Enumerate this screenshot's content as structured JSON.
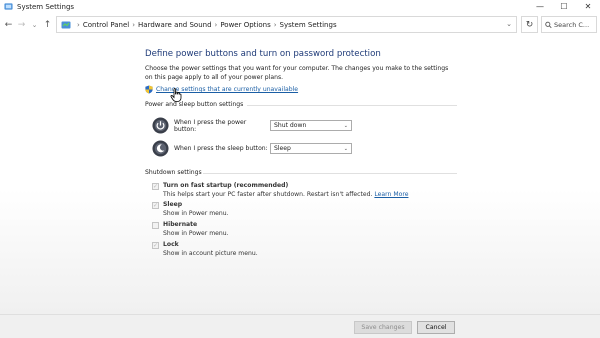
{
  "window": {
    "title": "System Settings",
    "controls": {
      "minimize": "—",
      "maximize": "☐",
      "close": "✕"
    }
  },
  "nav": {
    "back": "←",
    "forward": "→",
    "recent": "⌄",
    "up": "↑",
    "breadcrumb": [
      "Control Panel",
      "Hardware and Sound",
      "Power Options",
      "System Settings"
    ],
    "separator": "›",
    "dropdown": "⌄",
    "refresh": "↻",
    "search_placeholder": "Search C..."
  },
  "main": {
    "heading": "Define power buttons and turn on password protection",
    "description": "Choose the power settings that you want for your computer. The changes you make to the settings on this page apply to all of your power plans.",
    "change_link": "Change settings that are currently unavailable",
    "power_section_label": "Power and sleep button settings",
    "power_button": {
      "label": "When I press the power button:",
      "value": "Shut down"
    },
    "sleep_button": {
      "label": "When I press the sleep button:",
      "value": "Sleep"
    },
    "combo_arrow": "⌄",
    "shutdown_section_label": "Shutdown settings",
    "shutdown_options": [
      {
        "title": "Turn on fast startup (recommended)",
        "desc": "This helps start your PC faster after shutdown. Restart isn't affected.",
        "link": "Learn More",
        "checked": true,
        "mark": "✓"
      },
      {
        "title": "Sleep",
        "desc": "Show in Power menu.",
        "checked": true,
        "mark": "✓"
      },
      {
        "title": "Hibernate",
        "desc": "Show in Power menu.",
        "checked": false,
        "mark": ""
      },
      {
        "title": "Lock",
        "desc": "Show in account picture menu.",
        "checked": true,
        "mark": "✓"
      }
    ]
  },
  "footer": {
    "save_label": "Save changes",
    "cancel_label": "Cancel"
  },
  "colors": {
    "heading": "#1e3a78",
    "link": "#1a5ea5",
    "footer_bg": "#f0f0f0"
  }
}
